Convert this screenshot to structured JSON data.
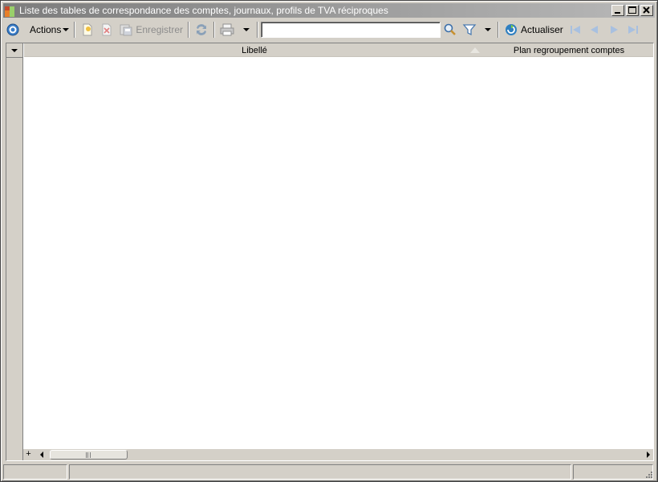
{
  "window": {
    "title": "Liste des tables de correspondance des comptes, journaux, profils de TVA réciproques",
    "controls": {
      "minimize": "_",
      "maximize": "□",
      "close": "✕"
    }
  },
  "toolbar": {
    "actions_label": "Actions",
    "save_label": "Enregistrer",
    "search_value": "",
    "refresh_label": "Actualiser"
  },
  "grid": {
    "columns": [
      {
        "label": "Libellé",
        "sorted": true
      },
      {
        "label": "Plan regroupement comptes",
        "sorted": false
      }
    ],
    "rows": [],
    "add_row_symbol": "+"
  },
  "statusbar": {
    "cells": [
      "",
      "",
      ""
    ]
  },
  "colors": {
    "title_gradient_start": "#7c7c7c",
    "title_gradient_end": "#b8b8b8",
    "chrome": "#d4d0c8",
    "accent_icon": "#2f7fc0"
  }
}
